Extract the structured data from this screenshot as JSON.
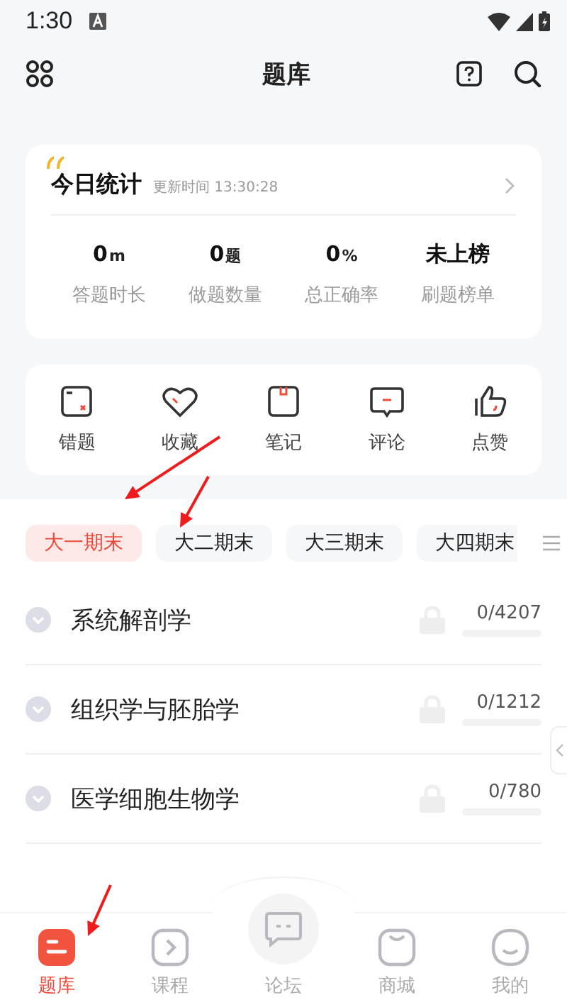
{
  "status_bar": {
    "time": "1:30"
  },
  "header": {
    "title": "题库"
  },
  "stats_card": {
    "title": "今日统计",
    "updated": "更新时间 13:30:28",
    "stats": [
      {
        "value": "0",
        "unit": "m",
        "label": "答题时长"
      },
      {
        "value": "0",
        "unit": "题",
        "label": "做题数量"
      },
      {
        "value": "0",
        "unit": "%",
        "label": "总正确率"
      },
      {
        "value": "未上榜",
        "label": "刷题榜单"
      }
    ]
  },
  "shortcuts": [
    {
      "label": "错题"
    },
    {
      "label": "收藏"
    },
    {
      "label": "笔记"
    },
    {
      "label": "评论"
    },
    {
      "label": "点赞"
    }
  ],
  "tabs": [
    {
      "label": "大一期末",
      "selected": true
    },
    {
      "label": "大二期末",
      "selected": false
    },
    {
      "label": "大三期末",
      "selected": false
    },
    {
      "label": "大四期末",
      "selected": false
    }
  ],
  "subjects": [
    {
      "name": "系统解剖学",
      "count": "0/4207",
      "level": 0,
      "locked": true
    },
    {
      "name": "组织学与胚胎学",
      "count": "0/1212",
      "level": 0,
      "locked": true
    },
    {
      "name": "医学细胞生物学",
      "count": "0/780",
      "level": 0,
      "locked": true
    }
  ],
  "nav": [
    {
      "label": "题库",
      "selected": true
    },
    {
      "label": "课程",
      "selected": false
    },
    {
      "label": "论坛",
      "selected": false
    },
    {
      "label": "商城",
      "selected": false
    },
    {
      "label": "我的",
      "selected": false
    }
  ]
}
